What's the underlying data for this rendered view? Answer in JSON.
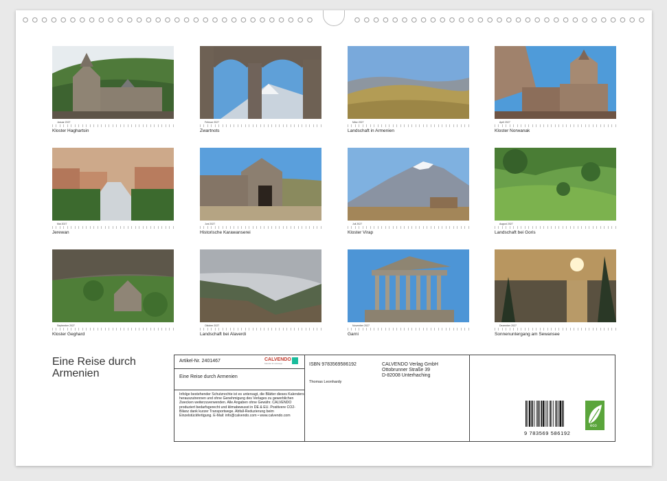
{
  "months": [
    {
      "month": "Januar 2027",
      "caption": "Kloster Haghartsin"
    },
    {
      "month": "Februar 2027",
      "caption": "Zwartnots"
    },
    {
      "month": "März 2027",
      "caption": "Landschaft in Armenien"
    },
    {
      "month": "April 2027",
      "caption": "Kloster Norwanak"
    },
    {
      "month": "Mai 2027",
      "caption": "Jerewan"
    },
    {
      "month": "Juni 2027",
      "caption": "Historische Karawanserei"
    },
    {
      "month": "Juli 2027",
      "caption": "Kloster Virap"
    },
    {
      "month": "August 2027",
      "caption": "Landschaft bei Goris"
    },
    {
      "month": "September 2027",
      "caption": "Kloster Geghard"
    },
    {
      "month": "Oktober 2027",
      "caption": "Landschaft bei Alaverdi"
    },
    {
      "month": "November 2027",
      "caption": "Garni"
    },
    {
      "month": "Dezember 2027",
      "caption": "Sonnenuntergang am Sewansee"
    }
  ],
  "title_line1": "Eine Reise durch",
  "title_line2": "Armenien",
  "info": {
    "artikel": "Artikel-Nr. 2401467",
    "logo": "CALVENDO",
    "logo_sub": "Kalender für unterwegs",
    "product_title": "Eine Reise durch Armenien",
    "legal": "Infolge bestehender Schutzrechte ist es untersagt, die Blätter dieses Kalenders herauszutrennen und ohne Genehmigung des Verlages zu gewerblichen Zwecken weiterzuverwenden. Alle Angaben ohne Gewähr. CALVENDO produziert bedarfsgerecht und klimabewusst in DE & EU. Positivere CO2-Bilanz dank kurzer Transportwege. Abfall-Reduzierung beim Einzelstückfertigung. E-Mail: info@calvendo.com • www.calvendo.com",
    "isbn": "ISBN 9783569586192",
    "author": "Thomas Leonhardy",
    "publisher1": "CALVENDO Verlag GmbH",
    "publisher2": "Ottobrunner Straße 39",
    "publisher3": "D-82008 Unterhaching",
    "barcode_digits": "9 783569 586192",
    "eco_label": "eco"
  }
}
